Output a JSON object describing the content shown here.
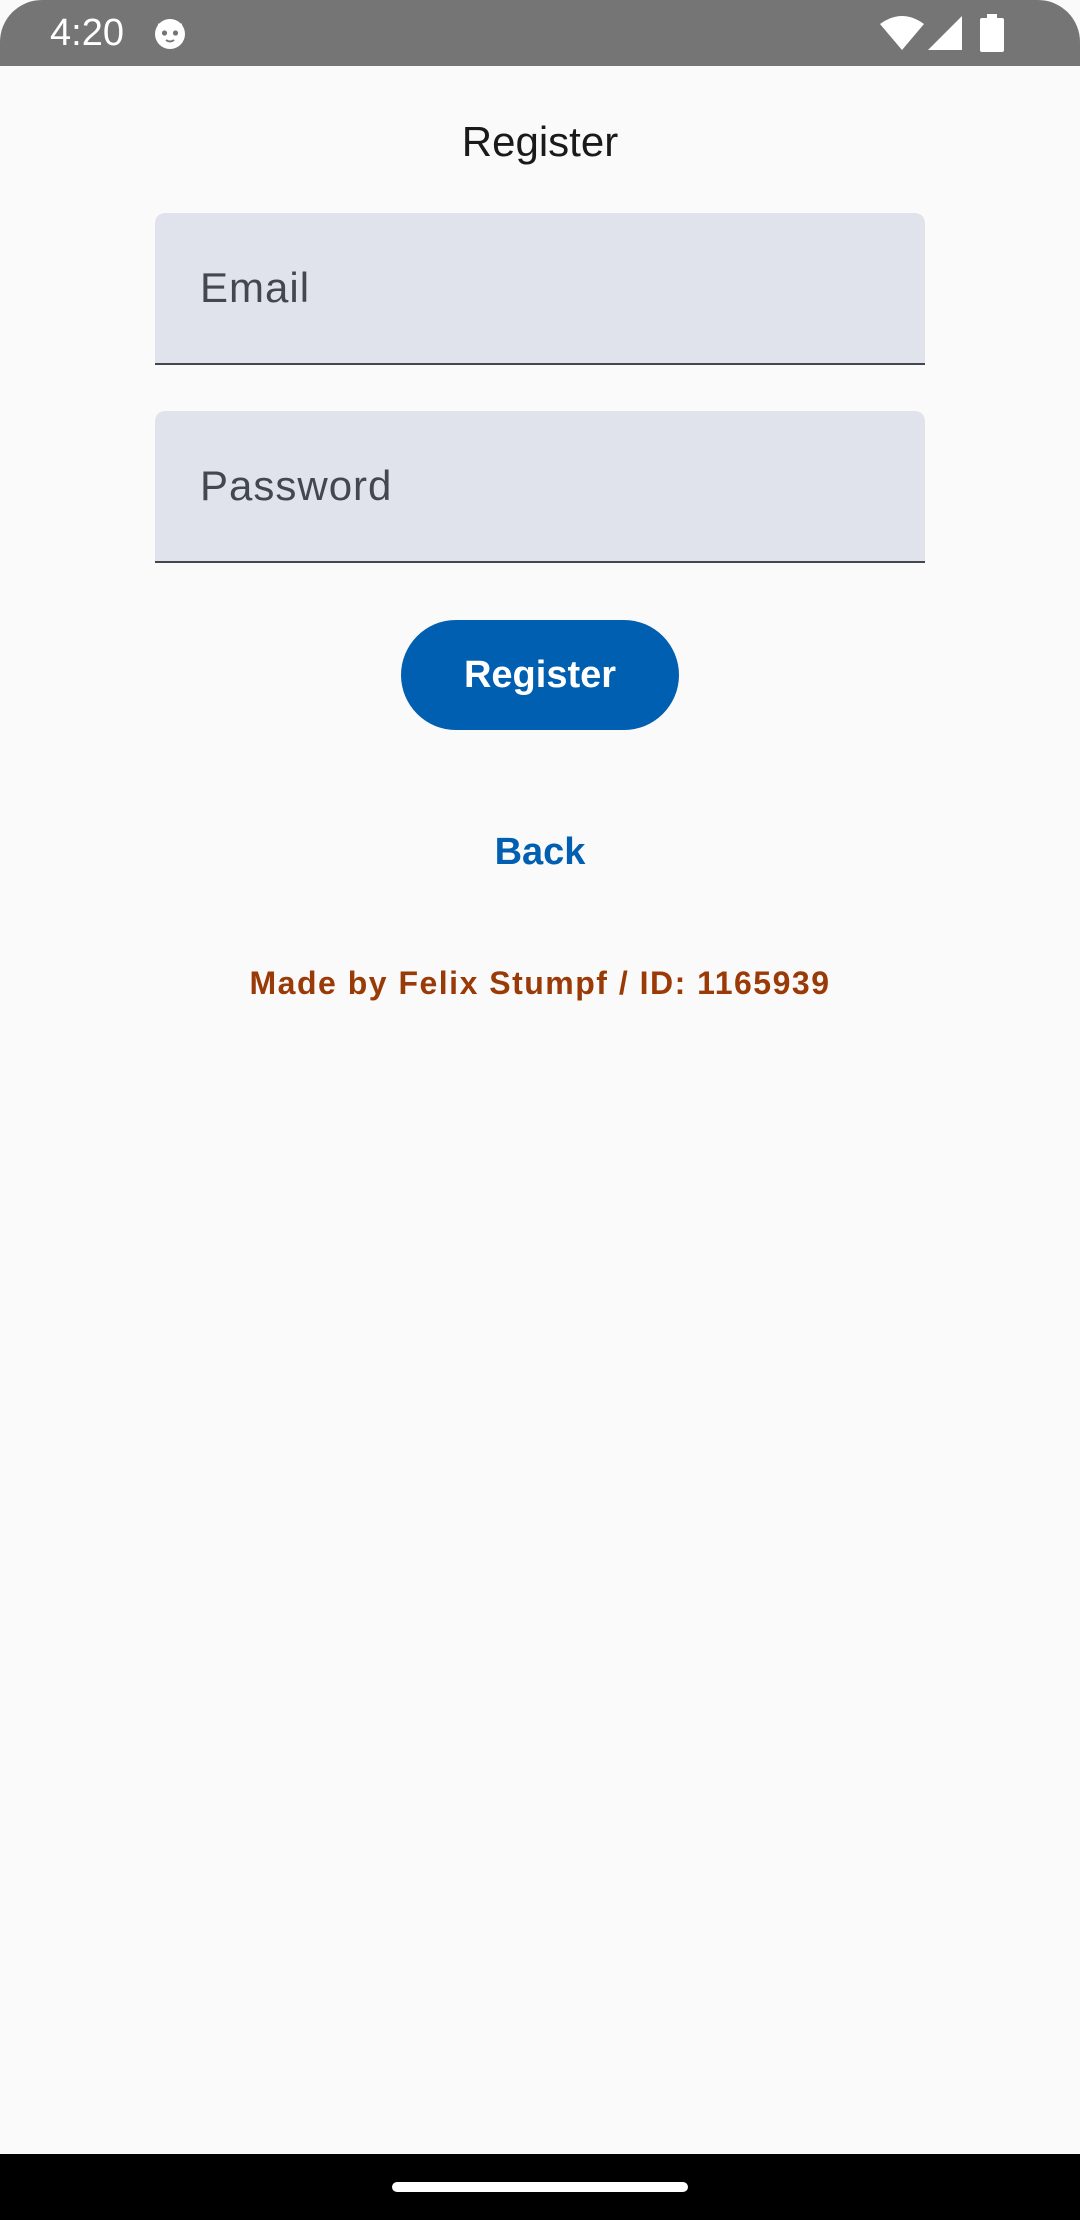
{
  "status_bar": {
    "time": "4:20",
    "app_icon": "cat-face-icon",
    "wifi_icon": "wifi-icon",
    "signal_icon": "cell-signal-icon",
    "battery_icon": "battery-full-icon"
  },
  "page": {
    "title": "Register"
  },
  "form": {
    "email": {
      "placeholder": "Email",
      "value": ""
    },
    "password": {
      "placeholder": "Password",
      "value": ""
    },
    "register_label": "Register",
    "back_label": "Back"
  },
  "footer": {
    "credit": "Made by Felix Stumpf / ID: 1165939"
  },
  "colors": {
    "accent": "#005fb0",
    "field_background": "#e0e3ec",
    "credit_text": "#9a3a06",
    "status_bar": "#757575"
  }
}
